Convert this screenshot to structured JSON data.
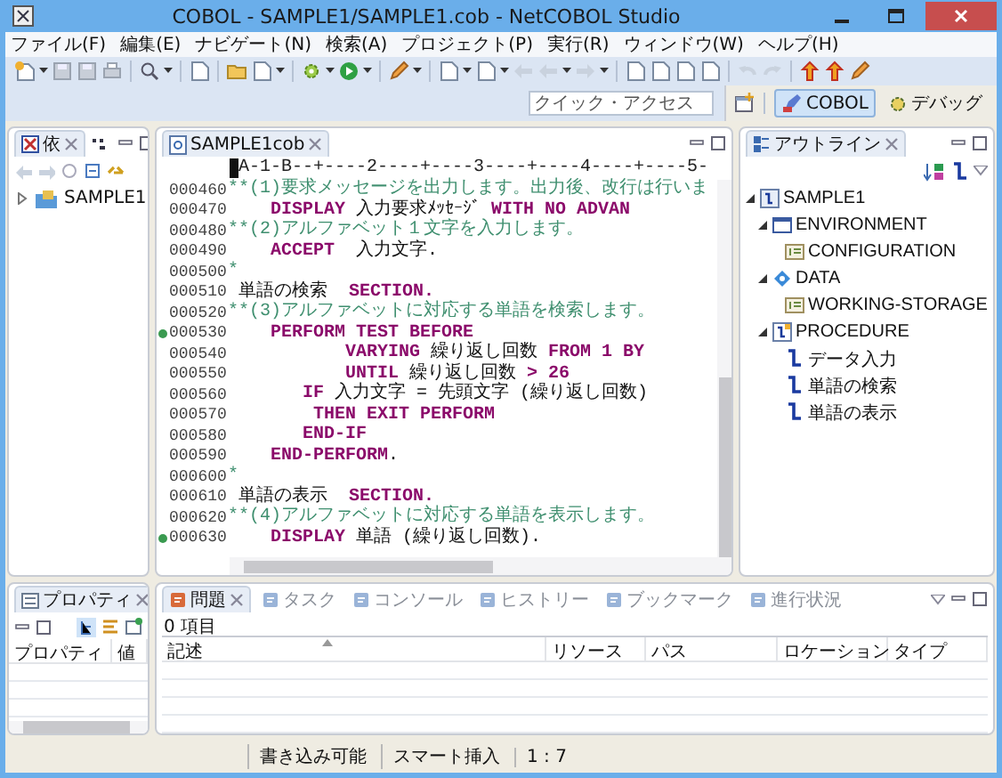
{
  "window": {
    "title": "COBOL - SAMPLE1/SAMPLE1.cob - NetCOBOL Studio"
  },
  "menu": [
    "ファイル(F)",
    "編集(E)",
    "ナビゲート(N)",
    "検索(A)",
    "プロジェクト(P)",
    "実行(R)",
    "ウィンドウ(W)",
    "ヘルプ(H)"
  ],
  "quick_access": {
    "placeholder": "クイック・アクセス"
  },
  "perspectives": [
    {
      "label": "COBOL",
      "selected": true
    },
    {
      "label": "デバッグ",
      "selected": false
    }
  ],
  "dependency_view": {
    "tab": "依",
    "tree": [
      {
        "label": "SAMPLE1",
        "expanded": false
      }
    ]
  },
  "editor": {
    "tab": "SAMPLE1cob",
    "ruler": "A-1-B--+----2----+----3----+----4----+----5-",
    "lines": [
      {
        "number": "000460",
        "breakpoint": false,
        "segments": [
          {
            "kind": "comment",
            "text": "**(1)要求メッセージを出力します。出力後、改行は行いま"
          }
        ]
      },
      {
        "number": "000470",
        "breakpoint": false,
        "segments": [
          {
            "kind": "keyword",
            "text": "    DISPLAY"
          },
          {
            "kind": "text",
            "text": " 入力要求ﾒｯｾｰｼﾞ "
          },
          {
            "kind": "keyword",
            "text": "WITH NO ADVAN"
          }
        ]
      },
      {
        "number": "000480",
        "breakpoint": false,
        "segments": [
          {
            "kind": "comment",
            "text": "**(2)アルファベット１文字を入力します。"
          }
        ]
      },
      {
        "number": "000490",
        "breakpoint": false,
        "segments": [
          {
            "kind": "keyword",
            "text": "    ACCEPT"
          },
          {
            "kind": "text",
            "text": "  入力文字."
          }
        ]
      },
      {
        "number": "000500",
        "breakpoint": false,
        "segments": [
          {
            "kind": "comment",
            "text": "*"
          }
        ]
      },
      {
        "number": "000510",
        "breakpoint": false,
        "segments": [
          {
            "kind": "text",
            "text": " 単語の検索  "
          },
          {
            "kind": "keyword",
            "text": "SECTION."
          }
        ]
      },
      {
        "number": "000520",
        "breakpoint": false,
        "segments": [
          {
            "kind": "comment",
            "text": "**(3)アルファベットに対応する単語を検索します。"
          }
        ]
      },
      {
        "number": "000530",
        "breakpoint": true,
        "segments": [
          {
            "kind": "keyword",
            "text": "    PERFORM TEST BEFORE"
          }
        ]
      },
      {
        "number": "000540",
        "breakpoint": false,
        "segments": [
          {
            "kind": "keyword",
            "text": "           VARYING"
          },
          {
            "kind": "text",
            "text": " 繰り返し回数 "
          },
          {
            "kind": "keyword",
            "text": "FROM 1 BY"
          }
        ]
      },
      {
        "number": "000550",
        "breakpoint": false,
        "segments": [
          {
            "kind": "keyword",
            "text": "           UNTIL"
          },
          {
            "kind": "text",
            "text": " 繰り返し回数 "
          },
          {
            "kind": "keyword",
            "text": "> 26"
          }
        ]
      },
      {
        "number": "000560",
        "breakpoint": false,
        "segments": [
          {
            "kind": "keyword",
            "text": "       IF"
          },
          {
            "kind": "text",
            "text": " 入力文字 = 先頭文字 (繰り返し回数)"
          }
        ]
      },
      {
        "number": "000570",
        "breakpoint": false,
        "segments": [
          {
            "kind": "keyword",
            "text": "        THEN EXIT PERFORM"
          }
        ]
      },
      {
        "number": "000580",
        "breakpoint": false,
        "segments": [
          {
            "kind": "keyword",
            "text": "       END-IF"
          }
        ]
      },
      {
        "number": "000590",
        "breakpoint": false,
        "segments": [
          {
            "kind": "keyword",
            "text": "    END-PERFORM"
          },
          {
            "kind": "text",
            "text": "."
          }
        ]
      },
      {
        "number": "000600",
        "breakpoint": false,
        "segments": [
          {
            "kind": "comment",
            "text": "*"
          }
        ]
      },
      {
        "number": "000610",
        "breakpoint": false,
        "segments": [
          {
            "kind": "text",
            "text": " 単語の表示  "
          },
          {
            "kind": "keyword",
            "text": "SECTION."
          }
        ]
      },
      {
        "number": "000620",
        "breakpoint": false,
        "segments": [
          {
            "kind": "comment",
            "text": "**(4)アルファベットに対応する単語を表示します。"
          }
        ]
      },
      {
        "number": "000630",
        "breakpoint": true,
        "segments": [
          {
            "kind": "keyword",
            "text": "    DISPLAY"
          },
          {
            "kind": "text",
            "text": " 単語 (繰り返し回数)."
          }
        ]
      }
    ]
  },
  "outline": {
    "tab": "アウトライン",
    "tree": [
      {
        "label": "SAMPLE1",
        "kind": "program",
        "expanded": true,
        "children": [
          {
            "label": "ENVIRONMENT",
            "kind": "environment",
            "expanded": true,
            "children": [
              {
                "label": "CONFIGURATION",
                "kind": "section"
              }
            ]
          },
          {
            "label": "DATA",
            "kind": "data",
            "expanded": true,
            "children": [
              {
                "label": "WORKING-STORAGE",
                "kind": "section"
              }
            ]
          },
          {
            "label": "PROCEDURE",
            "kind": "procedure",
            "expanded": true,
            "children": [
              {
                "label": "データ入力",
                "kind": "paragraph"
              },
              {
                "label": "単語の検索",
                "kind": "paragraph"
              },
              {
                "label": "単語の表示",
                "kind": "paragraph"
              }
            ]
          }
        ]
      }
    ]
  },
  "properties": {
    "tab": "プロパティ",
    "columns": [
      "プロパティ",
      "値"
    ]
  },
  "problems": {
    "tabs": [
      {
        "label": "問題",
        "selected": true
      },
      {
        "label": "タスク",
        "selected": false
      },
      {
        "label": "コンソール",
        "selected": false
      },
      {
        "label": "ヒストリー",
        "selected": false
      },
      {
        "label": "ブックマーク",
        "selected": false
      },
      {
        "label": "進行状況",
        "selected": false
      }
    ],
    "summary": "0 項目",
    "columns": [
      "記述",
      "リソース",
      "パス",
      "ロケーション",
      "タイプ"
    ]
  },
  "status_bar": [
    "書き込み可能",
    "スマート挿入",
    "1 : 7"
  ]
}
